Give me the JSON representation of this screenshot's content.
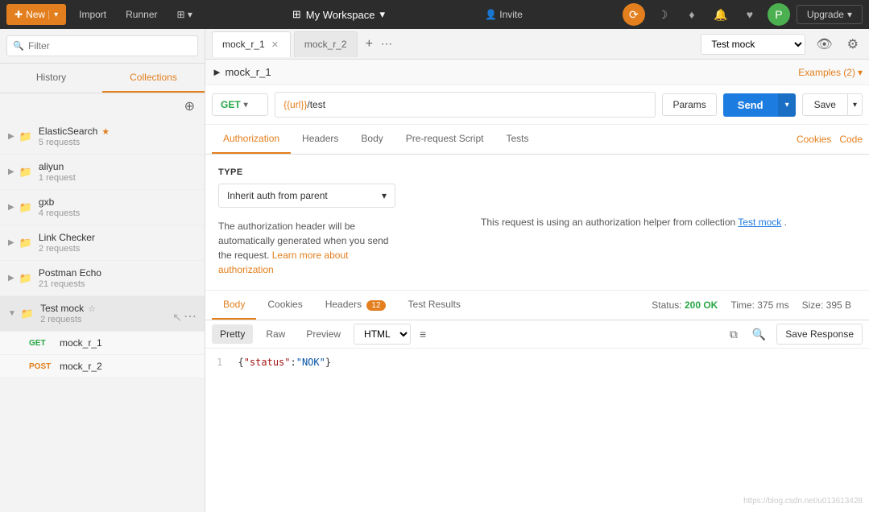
{
  "topbar": {
    "new_label": "New",
    "import_label": "Import",
    "runner_label": "Runner",
    "workspace_label": "My Workspace",
    "invite_label": "Invite",
    "upgrade_label": "Upgrade"
  },
  "sidebar": {
    "filter_placeholder": "Filter",
    "history_tab": "History",
    "collections_tab": "Collections",
    "collections": [
      {
        "name": "ElasticSearch",
        "count": "5 requests",
        "star": true
      },
      {
        "name": "aliyun",
        "count": "1 request",
        "star": false
      },
      {
        "name": "gxb",
        "count": "4 requests",
        "star": false
      },
      {
        "name": "Link Checker",
        "count": "2 requests",
        "star": false
      },
      {
        "name": "Postman Echo",
        "count": "21 requests",
        "star": false
      },
      {
        "name": "Test mock",
        "count": "2 requests",
        "star": false,
        "active": true
      }
    ],
    "requests": [
      {
        "method": "GET",
        "name": "mock_r_1"
      },
      {
        "method": "POST",
        "name": "mock_r_2"
      }
    ]
  },
  "tabs": {
    "tab1": "mock_r_1",
    "tab2": "mock_r_2",
    "add_label": "+",
    "more_label": "..."
  },
  "request": {
    "breadcrumb": "► mock_r_1",
    "examples_label": "Examples (2)",
    "method": "GET",
    "url": "{{url}}/test",
    "params_label": "Params",
    "send_label": "Send",
    "save_label": "Save",
    "mock_select": "Test mock"
  },
  "req_tabs": {
    "authorization": "Authorization",
    "headers": "Headers",
    "body": "Body",
    "pre_request": "Pre-request Script",
    "tests": "Tests",
    "cookies_link": "Cookies",
    "code_link": "Code"
  },
  "auth": {
    "type_label": "TYPE",
    "type_value": "Inherit auth from parent",
    "description": "The authorization header will be automatically generated when you send the request.",
    "learn_more": "Learn more about authorization",
    "info_text": "This request is using an authorization helper from collection",
    "collection_link": "Test mock",
    "info_period": "."
  },
  "response": {
    "body_tab": "Body",
    "cookies_tab": "Cookies",
    "headers_tab": "Headers",
    "headers_count": "12",
    "test_results_tab": "Test Results",
    "status_label": "Status:",
    "status_value": "200 OK",
    "time_label": "Time:",
    "time_value": "375 ms",
    "size_label": "Size:",
    "size_value": "395 B",
    "pretty_tab": "Pretty",
    "raw_tab": "Raw",
    "preview_tab": "Preview",
    "format": "HTML",
    "save_response_label": "Save Response",
    "body_line1": "1",
    "body_content": "{\"status\":\"NOK\"}"
  },
  "watermark": "https://blog.csdn.net/u013613428"
}
